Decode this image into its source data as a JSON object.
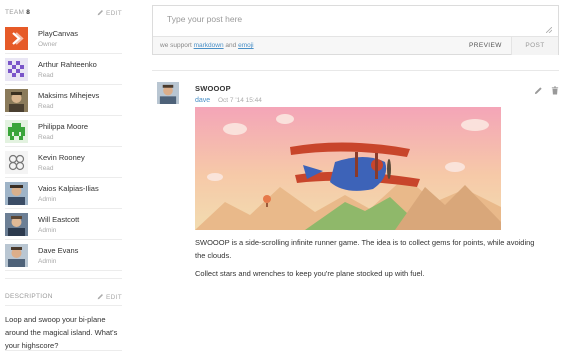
{
  "team": {
    "title": "TEAM",
    "count": "8",
    "edit_label": "EDIT",
    "members": [
      {
        "name": "PlayCanvas",
        "role": "Owner"
      },
      {
        "name": "Arthur Rahteenko",
        "role": "Read"
      },
      {
        "name": "Maksims Mihejevs",
        "role": "Read"
      },
      {
        "name": "Philippa Moore",
        "role": "Read"
      },
      {
        "name": "Kevin Rooney",
        "role": "Read"
      },
      {
        "name": "Vaios Kalpias-Ilias",
        "role": "Admin"
      },
      {
        "name": "Will Eastcott",
        "role": "Admin"
      },
      {
        "name": "Dave Evans",
        "role": "Admin"
      }
    ]
  },
  "description": {
    "title": "DESCRIPTION",
    "edit_label": "EDIT",
    "text": "Loop and swoop your bi-plane around the magical island. What's your highscore?"
  },
  "composer": {
    "placeholder": "Type your post here",
    "support_prefix": "we support",
    "markdown_link": "markdown",
    "and_word": "and",
    "emoji_link": "emoji",
    "preview_label": "PREVIEW",
    "post_label": "POST"
  },
  "post": {
    "title": "SWOOOP",
    "author": "dave",
    "date": "Oct 7 '14 15:44",
    "paragraphs": [
      "SWOOOP is a side-scrolling infinite runner game. The idea is to collect gems for points, while avoiding the clouds.",
      "Collect stars and wrenches to keep you're plane stocked up with fuel."
    ]
  },
  "colors": {
    "link": "#4a90c7",
    "playcanvas_orange": "#e65a28"
  },
  "icons": [
    "pencil-icon",
    "trash-icon",
    "resize-grip-icon"
  ]
}
